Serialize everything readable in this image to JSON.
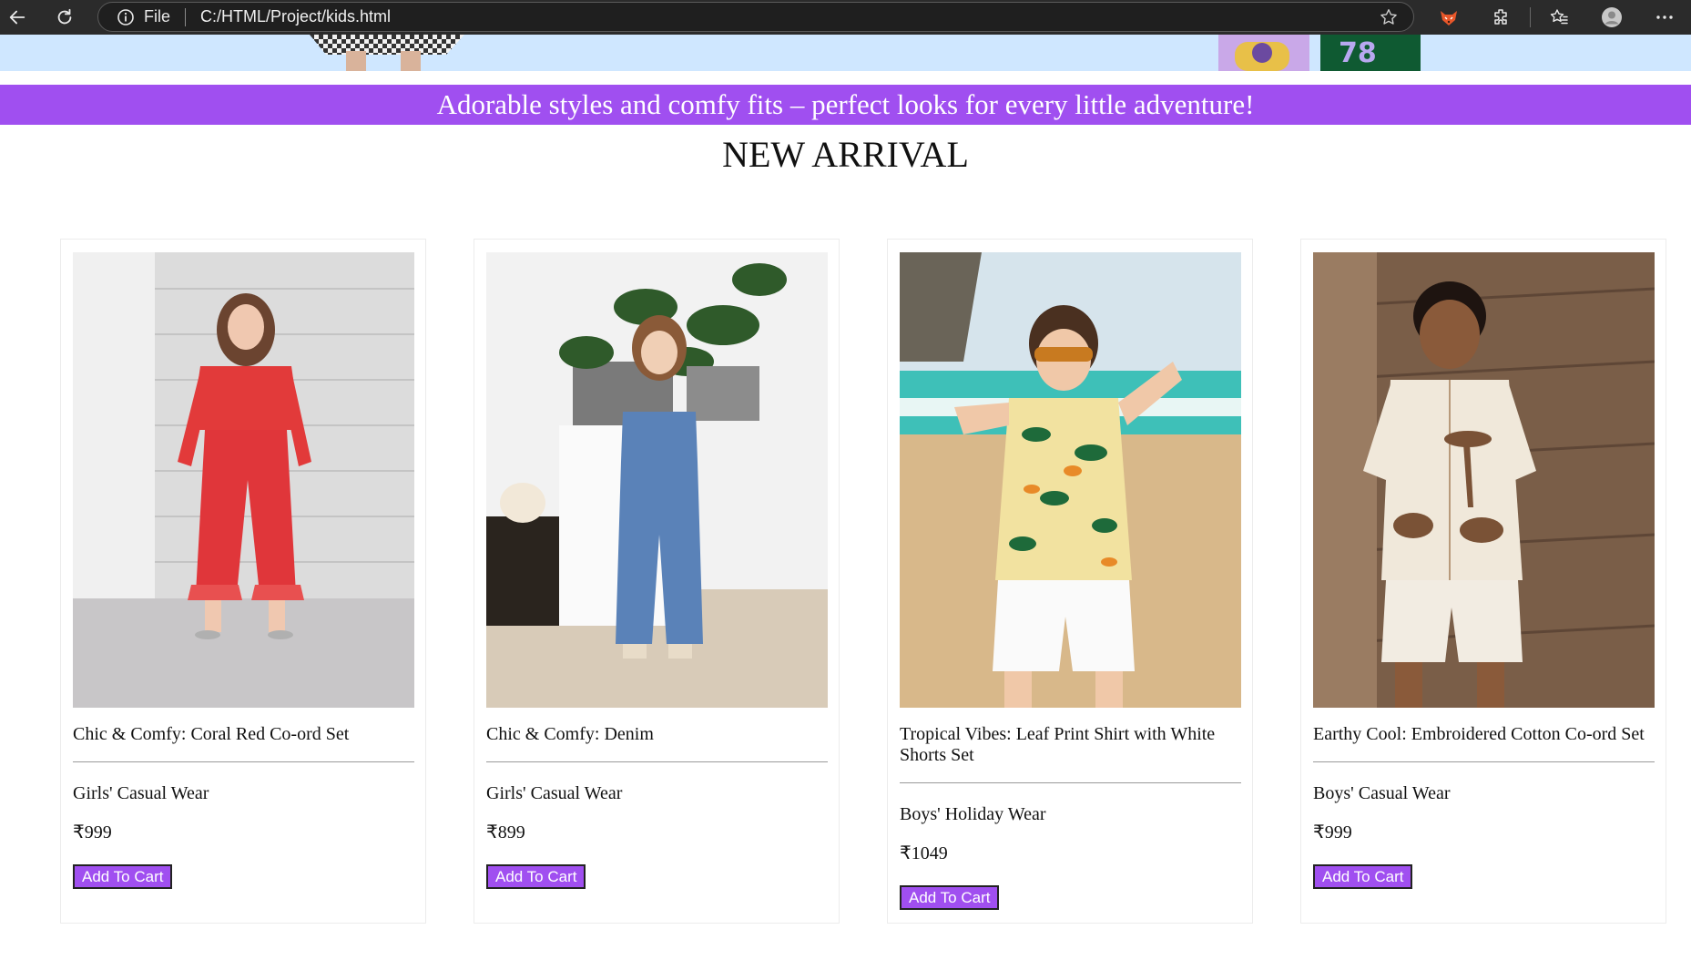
{
  "browser": {
    "file_label": "File",
    "url": "C:/HTML/Project/kids.html"
  },
  "banner": {
    "text": "Adorable styles and comfy fits – perfect looks for every little adventure!"
  },
  "section": {
    "title": "NEW ARRIVAL"
  },
  "products": [
    {
      "name": "Chic & Comfy: Coral Red Co-ord Set",
      "category": "Girls' Casual Wear",
      "price": "₹999",
      "button": "Add To Cart"
    },
    {
      "name": "Chic & Comfy: Denim",
      "category": "Girls' Casual Wear",
      "price": "₹899",
      "button": "Add To Cart"
    },
    {
      "name": "Tropical Vibes: Leaf Print Shirt with White Shorts Set",
      "category": "Boys' Holiday Wear",
      "price": "₹1049",
      "button": "Add To Cart"
    },
    {
      "name": "Earthy Cool: Embroidered Cotton Co-ord Set",
      "category": "Boys' Casual Wear",
      "price": "₹999",
      "button": "Add To Cart"
    }
  ],
  "colors": {
    "accent": "#a04ff0",
    "hero_background": "#cfe7ff",
    "chrome_background": "#2b2b2b"
  }
}
